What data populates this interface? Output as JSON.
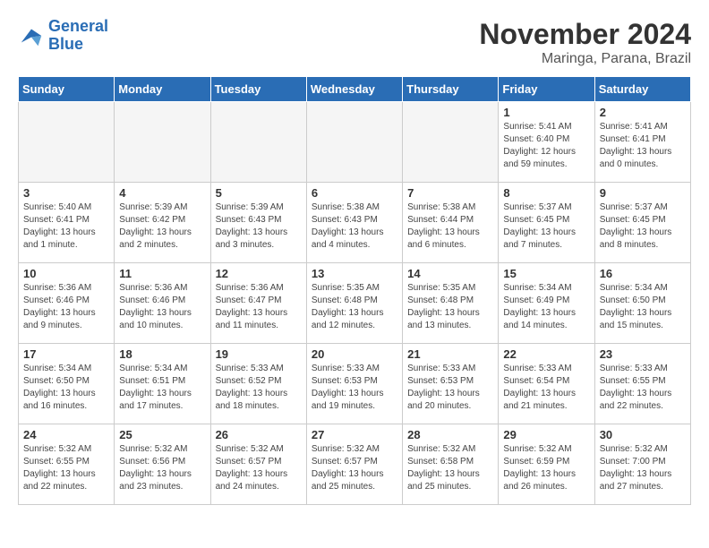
{
  "header": {
    "logo_line1": "General",
    "logo_line2": "Blue",
    "month": "November 2024",
    "location": "Maringa, Parana, Brazil"
  },
  "weekdays": [
    "Sunday",
    "Monday",
    "Tuesday",
    "Wednesday",
    "Thursday",
    "Friday",
    "Saturday"
  ],
  "weeks": [
    [
      {
        "day": "",
        "info": ""
      },
      {
        "day": "",
        "info": ""
      },
      {
        "day": "",
        "info": ""
      },
      {
        "day": "",
        "info": ""
      },
      {
        "day": "",
        "info": ""
      },
      {
        "day": "1",
        "info": "Sunrise: 5:41 AM\nSunset: 6:40 PM\nDaylight: 12 hours\nand 59 minutes."
      },
      {
        "day": "2",
        "info": "Sunrise: 5:41 AM\nSunset: 6:41 PM\nDaylight: 13 hours\nand 0 minutes."
      }
    ],
    [
      {
        "day": "3",
        "info": "Sunrise: 5:40 AM\nSunset: 6:41 PM\nDaylight: 13 hours\nand 1 minute."
      },
      {
        "day": "4",
        "info": "Sunrise: 5:39 AM\nSunset: 6:42 PM\nDaylight: 13 hours\nand 2 minutes."
      },
      {
        "day": "5",
        "info": "Sunrise: 5:39 AM\nSunset: 6:43 PM\nDaylight: 13 hours\nand 3 minutes."
      },
      {
        "day": "6",
        "info": "Sunrise: 5:38 AM\nSunset: 6:43 PM\nDaylight: 13 hours\nand 4 minutes."
      },
      {
        "day": "7",
        "info": "Sunrise: 5:38 AM\nSunset: 6:44 PM\nDaylight: 13 hours\nand 6 minutes."
      },
      {
        "day": "8",
        "info": "Sunrise: 5:37 AM\nSunset: 6:45 PM\nDaylight: 13 hours\nand 7 minutes."
      },
      {
        "day": "9",
        "info": "Sunrise: 5:37 AM\nSunset: 6:45 PM\nDaylight: 13 hours\nand 8 minutes."
      }
    ],
    [
      {
        "day": "10",
        "info": "Sunrise: 5:36 AM\nSunset: 6:46 PM\nDaylight: 13 hours\nand 9 minutes."
      },
      {
        "day": "11",
        "info": "Sunrise: 5:36 AM\nSunset: 6:46 PM\nDaylight: 13 hours\nand 10 minutes."
      },
      {
        "day": "12",
        "info": "Sunrise: 5:36 AM\nSunset: 6:47 PM\nDaylight: 13 hours\nand 11 minutes."
      },
      {
        "day": "13",
        "info": "Sunrise: 5:35 AM\nSunset: 6:48 PM\nDaylight: 13 hours\nand 12 minutes."
      },
      {
        "day": "14",
        "info": "Sunrise: 5:35 AM\nSunset: 6:48 PM\nDaylight: 13 hours\nand 13 minutes."
      },
      {
        "day": "15",
        "info": "Sunrise: 5:34 AM\nSunset: 6:49 PM\nDaylight: 13 hours\nand 14 minutes."
      },
      {
        "day": "16",
        "info": "Sunrise: 5:34 AM\nSunset: 6:50 PM\nDaylight: 13 hours\nand 15 minutes."
      }
    ],
    [
      {
        "day": "17",
        "info": "Sunrise: 5:34 AM\nSunset: 6:50 PM\nDaylight: 13 hours\nand 16 minutes."
      },
      {
        "day": "18",
        "info": "Sunrise: 5:34 AM\nSunset: 6:51 PM\nDaylight: 13 hours\nand 17 minutes."
      },
      {
        "day": "19",
        "info": "Sunrise: 5:33 AM\nSunset: 6:52 PM\nDaylight: 13 hours\nand 18 minutes."
      },
      {
        "day": "20",
        "info": "Sunrise: 5:33 AM\nSunset: 6:53 PM\nDaylight: 13 hours\nand 19 minutes."
      },
      {
        "day": "21",
        "info": "Sunrise: 5:33 AM\nSunset: 6:53 PM\nDaylight: 13 hours\nand 20 minutes."
      },
      {
        "day": "22",
        "info": "Sunrise: 5:33 AM\nSunset: 6:54 PM\nDaylight: 13 hours\nand 21 minutes."
      },
      {
        "day": "23",
        "info": "Sunrise: 5:33 AM\nSunset: 6:55 PM\nDaylight: 13 hours\nand 22 minutes."
      }
    ],
    [
      {
        "day": "24",
        "info": "Sunrise: 5:32 AM\nSunset: 6:55 PM\nDaylight: 13 hours\nand 22 minutes."
      },
      {
        "day": "25",
        "info": "Sunrise: 5:32 AM\nSunset: 6:56 PM\nDaylight: 13 hours\nand 23 minutes."
      },
      {
        "day": "26",
        "info": "Sunrise: 5:32 AM\nSunset: 6:57 PM\nDaylight: 13 hours\nand 24 minutes."
      },
      {
        "day": "27",
        "info": "Sunrise: 5:32 AM\nSunset: 6:57 PM\nDaylight: 13 hours\nand 25 minutes."
      },
      {
        "day": "28",
        "info": "Sunrise: 5:32 AM\nSunset: 6:58 PM\nDaylight: 13 hours\nand 25 minutes."
      },
      {
        "day": "29",
        "info": "Sunrise: 5:32 AM\nSunset: 6:59 PM\nDaylight: 13 hours\nand 26 minutes."
      },
      {
        "day": "30",
        "info": "Sunrise: 5:32 AM\nSunset: 7:00 PM\nDaylight: 13 hours\nand 27 minutes."
      }
    ]
  ]
}
